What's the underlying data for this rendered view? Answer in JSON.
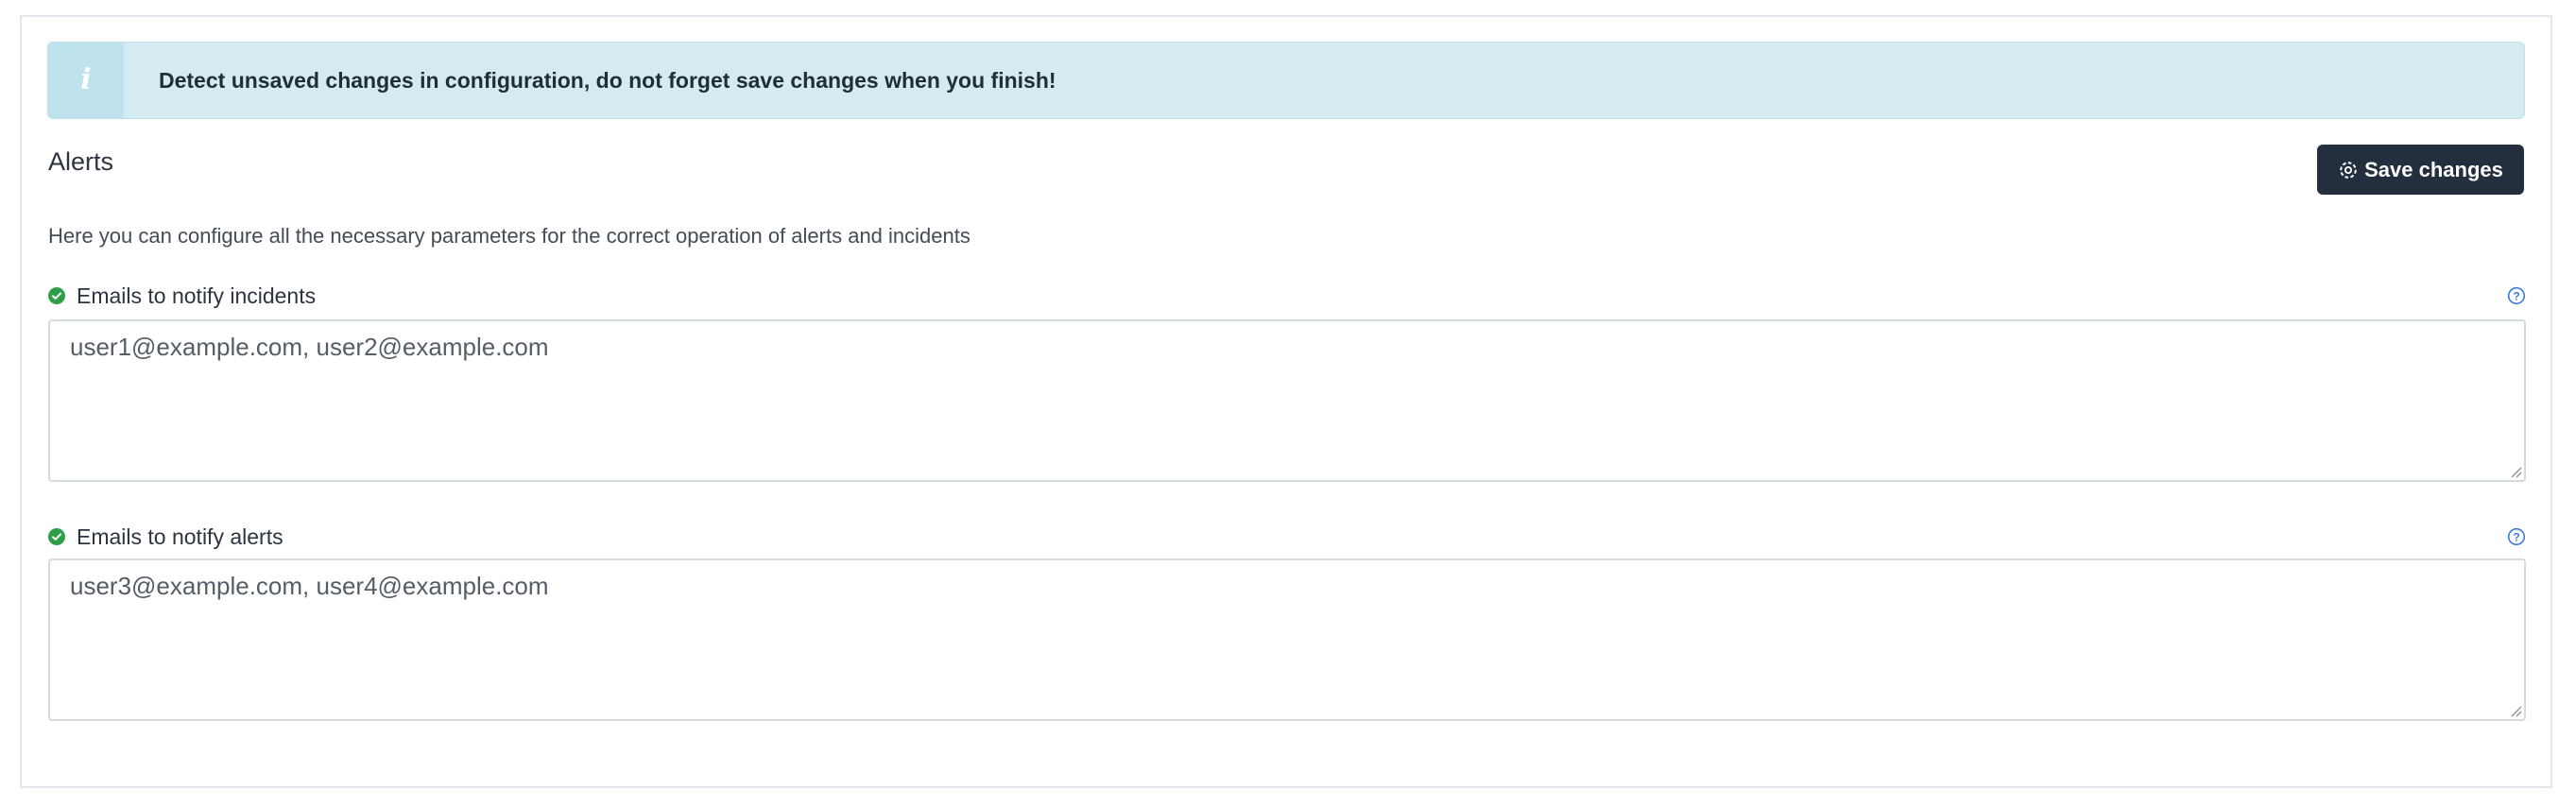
{
  "banner": {
    "icon": "info-icon",
    "icon_glyph": "i",
    "message": "Detect unsaved changes in configuration, do not forget save changes when you finish!"
  },
  "section": {
    "title": "Alerts",
    "description": "Here you can configure all the necessary parameters for the correct operation of alerts and incidents"
  },
  "toolbar": {
    "save_label": "Save changes",
    "save_icon": "gear-icon"
  },
  "fields": [
    {
      "label": "Emails to notify incidents",
      "value": "user1@example.com, user2@example.com",
      "status_icon": "check-circle-icon",
      "help_icon": "help-icon"
    },
    {
      "label": "Emails to notify alerts",
      "value": "user3@example.com, user4@example.com",
      "status_icon": "check-circle-icon",
      "help_icon": "help-icon"
    }
  ],
  "colors": {
    "banner_bg": "#d3ebf1",
    "button_bg": "#232f3e",
    "valid_green": "#2e9e48",
    "help_blue": "#3b7bd6"
  }
}
